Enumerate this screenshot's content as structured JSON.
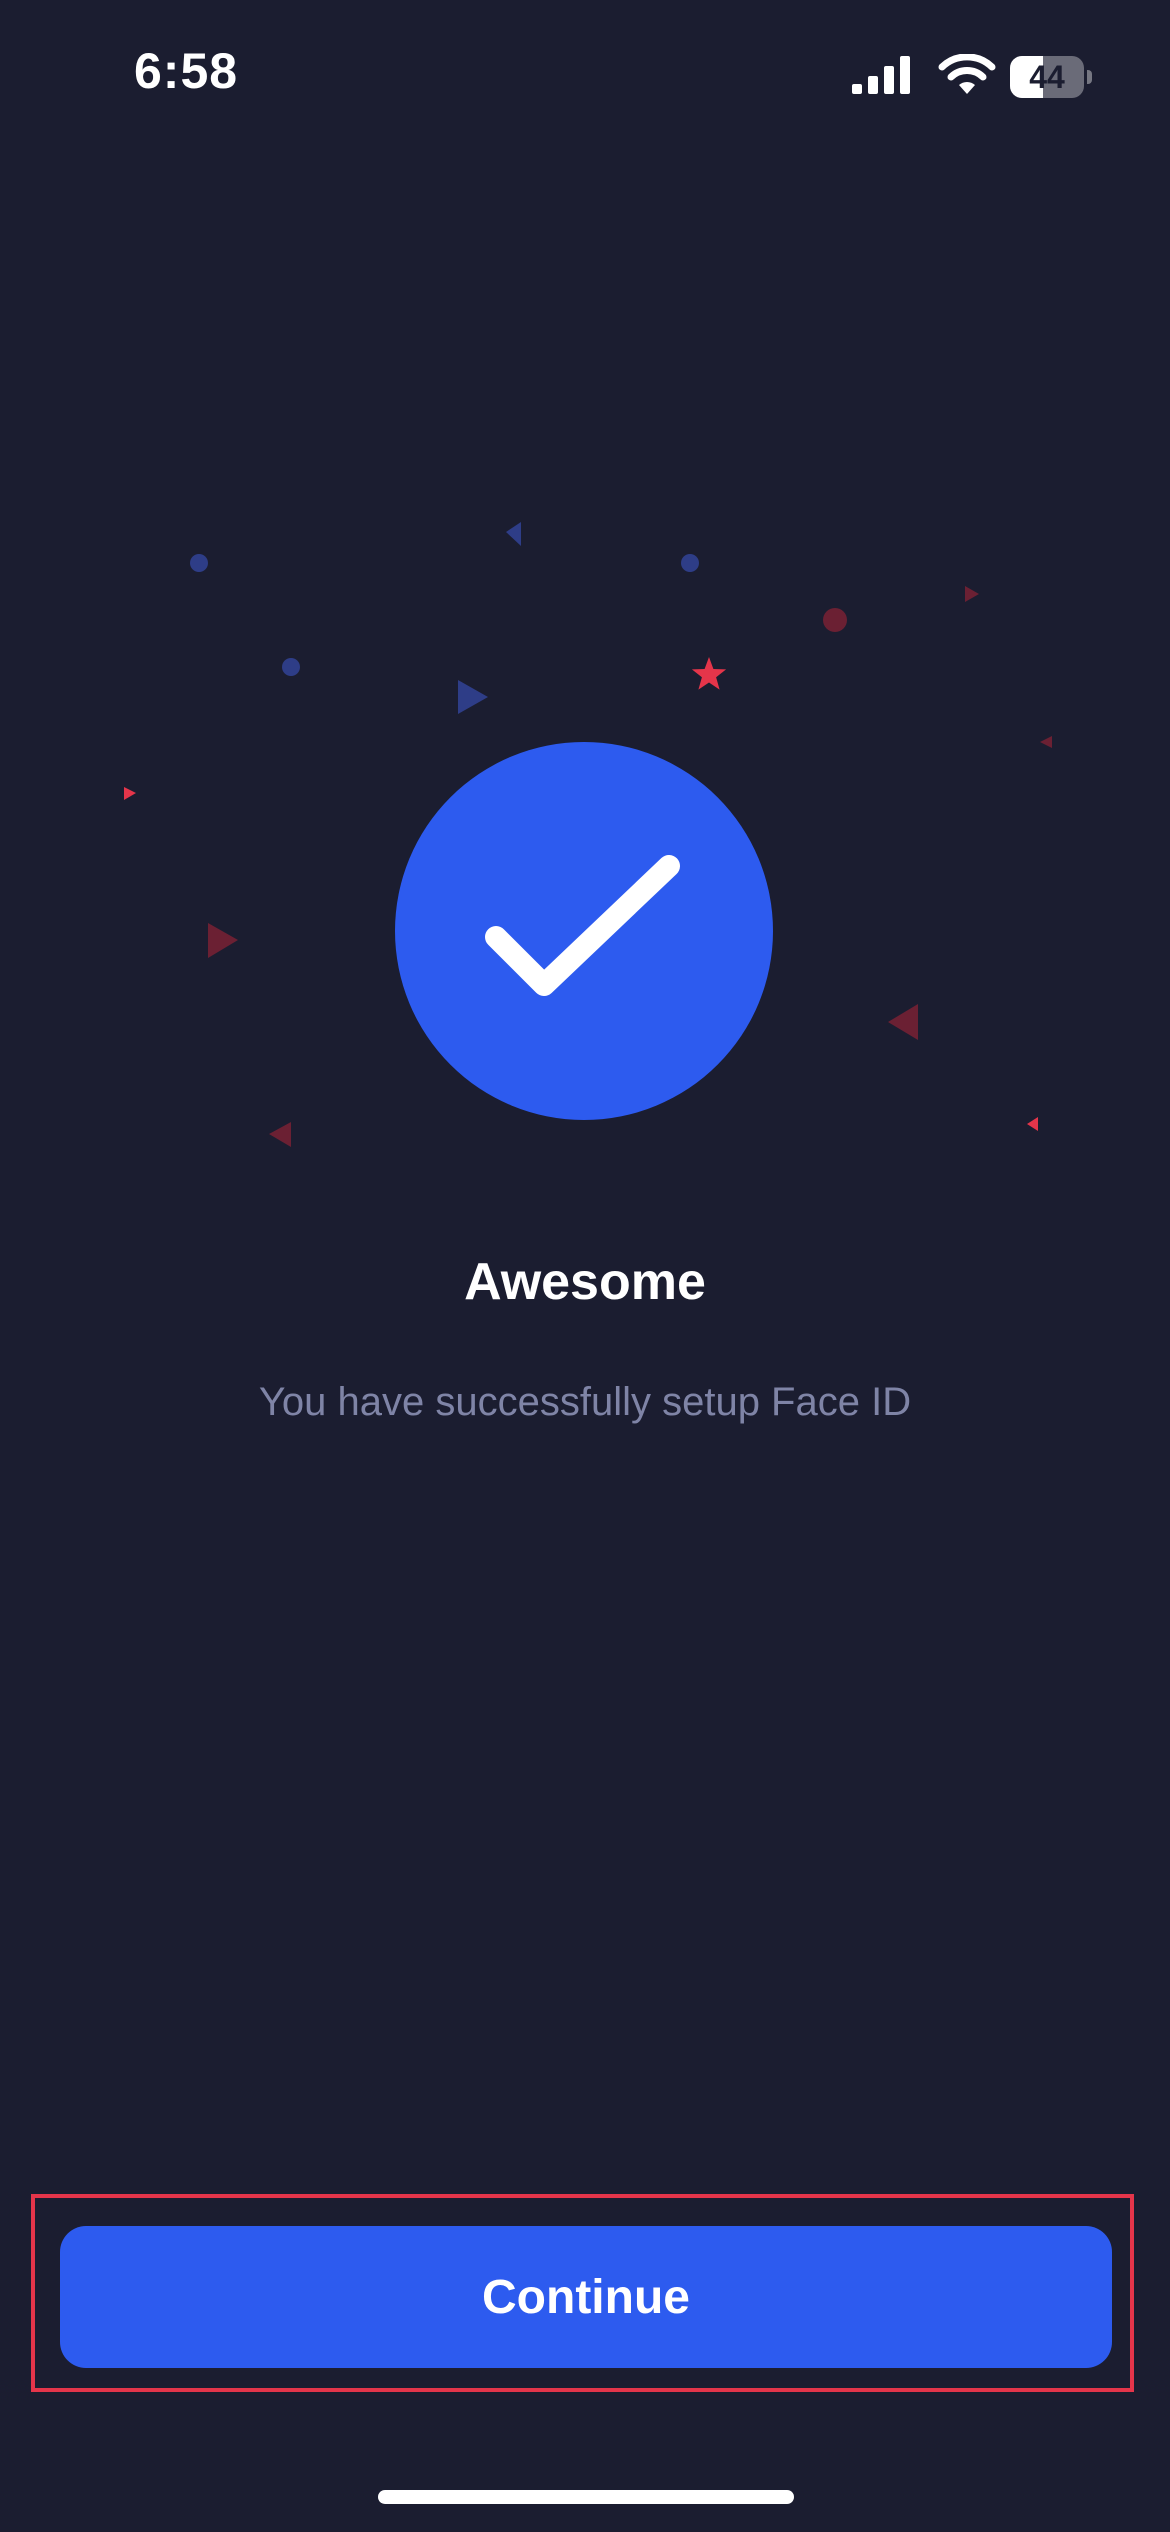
{
  "status_bar": {
    "time": "6:58",
    "battery_level": "44",
    "battery_fraction": 0.44,
    "icons": [
      "cellular-signal-icon",
      "wifi-icon",
      "battery-icon"
    ]
  },
  "success": {
    "icon": "checkmark-icon",
    "title": "Awesome",
    "message": "You have successfully setup Face ID"
  },
  "actions": {
    "continue_label": "Continue"
  },
  "colors": {
    "background": "#1b1d30",
    "accent": "#2d5bef",
    "subtitle_text": "#7f84a6",
    "confetti_blue": "#2e3d87",
    "confetti_red": "#6b2033",
    "confetti_red_bright": "#e5354a",
    "highlight_frame": "#e5354a"
  }
}
